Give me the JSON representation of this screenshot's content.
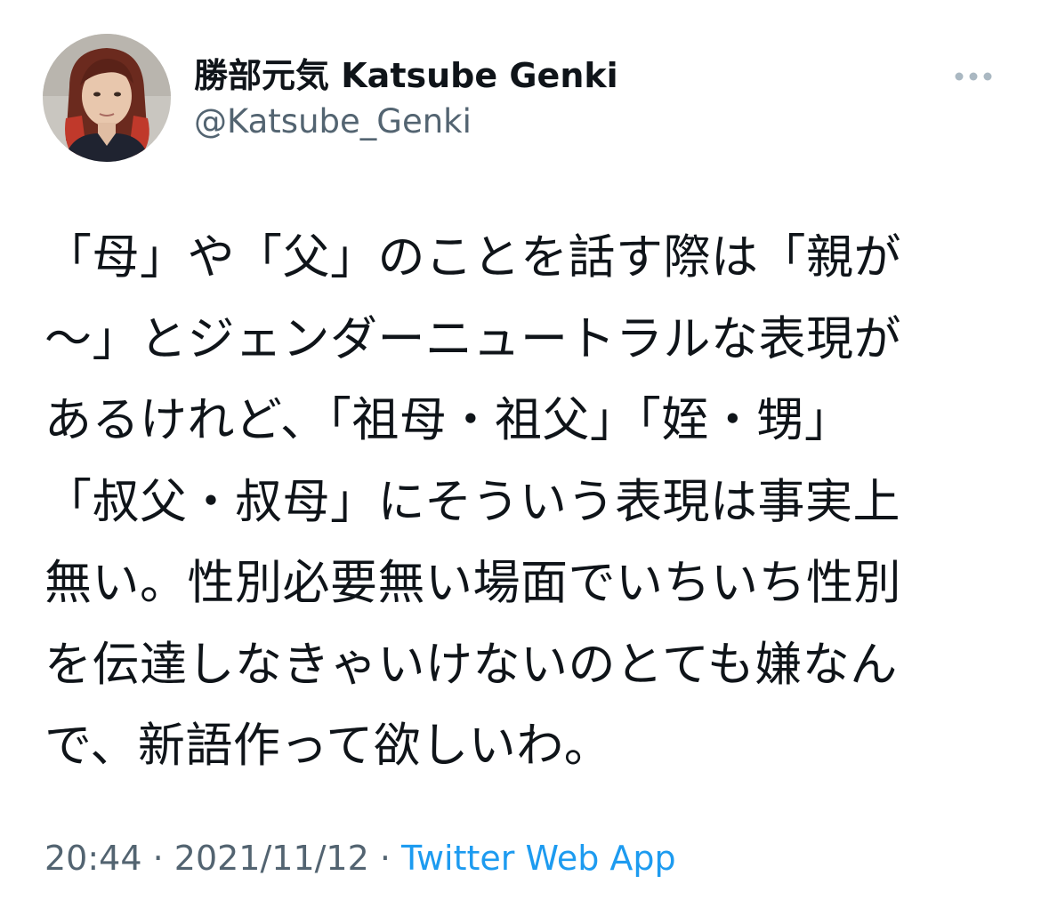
{
  "author": {
    "display_name": "勝部元気 Katsube Genki",
    "handle": "@Katsube_Genki"
  },
  "more_icon": "more-horizontal-icon",
  "tweet": {
    "lines": [
      "「母」や「父」のことを話す際は「親が",
      "〜」とジェンダーニュートラルな表現が",
      "あるけれど、「祖母・祖父」「姪・甥」",
      "「叔父・叔母」にそういう表現は事実上",
      "無い。性別必要無い場面でいちいち性別",
      "を伝達しなきゃいけないのとても嫌なん",
      "で、新語作って欲しいわ。"
    ]
  },
  "meta": {
    "time": "20:44",
    "separator": " · ",
    "date": "2021/11/12",
    "source": "Twitter Web App"
  },
  "colors": {
    "text": "#0f1419",
    "secondary": "#536471",
    "link": "#1d9bf0",
    "more_dots": "#aab8c2"
  }
}
